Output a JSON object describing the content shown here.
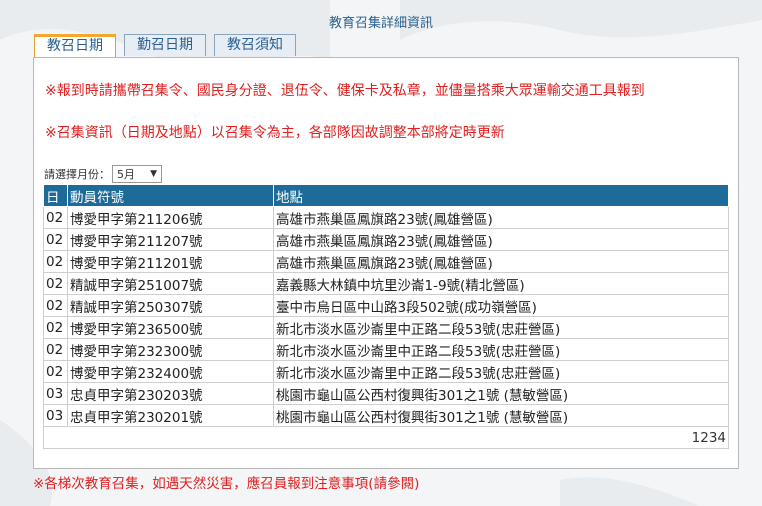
{
  "page_title": "教育召集詳細資訊",
  "tabs": [
    {
      "label": "教召日期",
      "active": true
    },
    {
      "label": "勤召日期",
      "active": false
    },
    {
      "label": "教召須知",
      "active": false
    }
  ],
  "notices": [
    "※報到時請攜帶召集令、國民身分證、退伍令、健保卡及私章，並儘量搭乘大眾運輸交通工具報到",
    "※召集資訊（日期及地點）以召集令為主，各部隊因故調整本部將定時更新"
  ],
  "month_filter": {
    "label": "請選擇月份：",
    "selected": "5月"
  },
  "table": {
    "headers": [
      "日",
      "動員符號",
      "地點"
    ],
    "rows": [
      [
        "02",
        "博愛甲字第211206號",
        "高雄市燕巢區鳳旗路23號(鳳雄營區)"
      ],
      [
        "02",
        "博愛甲字第211207號",
        "高雄市燕巢區鳳旗路23號(鳳雄營區)"
      ],
      [
        "02",
        "博愛甲字第211201號",
        "高雄市燕巢區鳳旗路23號(鳳雄營區)"
      ],
      [
        "02",
        "精誠甲字第251007號",
        "嘉義縣大林鎮中坑里沙崙1-9號(精北營區)"
      ],
      [
        "02",
        "精誠甲字第250307號",
        "臺中市烏日區中山路3段502號(成功嶺營區)"
      ],
      [
        "02",
        "博愛甲字第236500號",
        "新北市淡水區沙崙里中正路二段53號(忠莊營區)"
      ],
      [
        "02",
        "博愛甲字第232300號",
        "新北市淡水區沙崙里中正路二段53號(忠莊營區)"
      ],
      [
        "02",
        "博愛甲字第232400號",
        "新北市淡水區沙崙里中正路二段53號(忠莊營區)"
      ],
      [
        "03",
        "忠貞甲字第230203號",
        "桃園市龜山區公西村復興街301之1號 (慧敏營區)"
      ],
      [
        "03",
        "忠貞甲字第230201號",
        "桃園市龜山區公西村復興街301之1號 (慧敏營區)"
      ]
    ],
    "pages": [
      "1",
      "2",
      "3",
      "4"
    ]
  },
  "footer_note": "※各梯次教育召集，如遇天然災害，應召員報到注意事項(請參閱)",
  "colors": {
    "accent": "#1d6b99",
    "notice": "#e02020",
    "tab_active_border": "#f0a830"
  }
}
